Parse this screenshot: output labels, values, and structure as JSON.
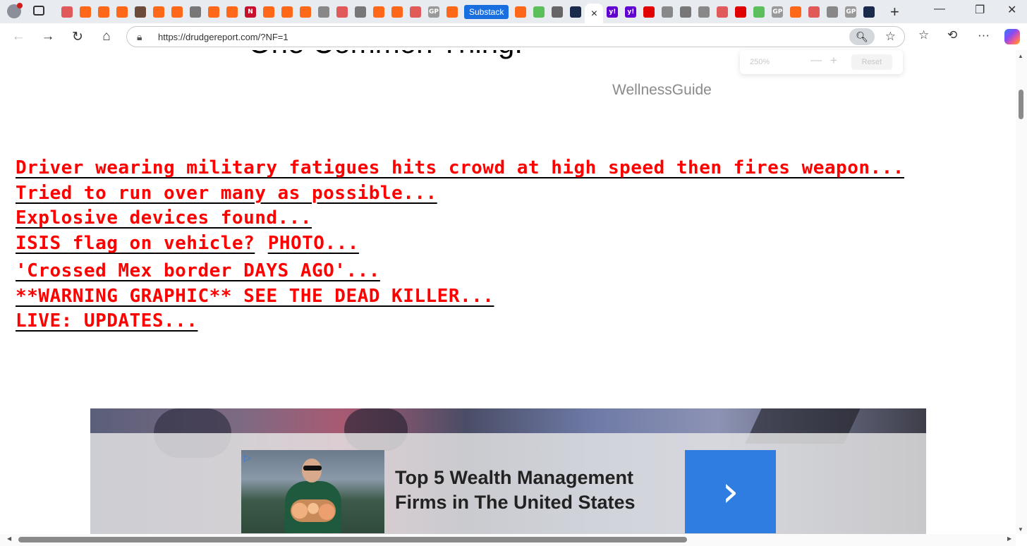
{
  "browser": {
    "tabs": [
      {
        "icon": "youtube-icon",
        "color": "#e05a5a"
      },
      {
        "icon": "substack-icon",
        "color": "#ff6719"
      },
      {
        "icon": "substack-icon",
        "color": "#ff6719"
      },
      {
        "icon": "substack-icon",
        "color": "#ff6719"
      },
      {
        "icon": "avatar-icon",
        "color": "#6b4a3a"
      },
      {
        "icon": "substack-icon",
        "color": "#ff6719"
      },
      {
        "icon": "substack-icon",
        "color": "#ff6719"
      },
      {
        "icon": "lock-icon",
        "color": "#777777"
      },
      {
        "icon": "substack-icon",
        "color": "#ff6719"
      },
      {
        "icon": "substack-icon",
        "color": "#ff6719"
      },
      {
        "icon": "newsmax-icon",
        "color": "#c8102e",
        "letter": "N"
      },
      {
        "icon": "substack-icon",
        "color": "#ff6719"
      },
      {
        "icon": "substack-icon",
        "color": "#ff6719"
      },
      {
        "icon": "substack-icon",
        "color": "#ff6719"
      },
      {
        "icon": "audio-icon",
        "color": "#888888"
      },
      {
        "icon": "youtube-icon",
        "color": "#e05a5a"
      },
      {
        "icon": "mk-icon",
        "color": "#777777"
      },
      {
        "icon": "substack-icon",
        "color": "#ff6719"
      },
      {
        "icon": "substack-icon",
        "color": "#ff6719"
      },
      {
        "icon": "youtube-icon",
        "color": "#e05a5a"
      },
      {
        "icon": "gp-icon",
        "color": "#999999",
        "letter": "GP"
      },
      {
        "icon": "substack-icon",
        "color": "#ff6719"
      }
    ],
    "substack_tab_label": "Substack",
    "tabs_after": [
      {
        "icon": "substack-icon",
        "color": "#ff6719"
      },
      {
        "icon": "play-icon",
        "color": "#5bbf5b"
      },
      {
        "icon": "search-icon",
        "color": "#666666"
      },
      {
        "icon": "fox-icon",
        "color": "#1a2a4a"
      }
    ],
    "tabs_end": [
      {
        "icon": "yahoo-icon",
        "color": "#6001d2",
        "letter": "y!"
      },
      {
        "icon": "yahoo-icon",
        "color": "#6001d2",
        "letter": "y!"
      },
      {
        "icon": "youtube-icon",
        "color": "#e00000"
      },
      {
        "icon": "mail-icon",
        "color": "#888888"
      },
      {
        "icon": "face-icon",
        "color": "#777777"
      },
      {
        "icon": "bird-icon",
        "color": "#888888"
      },
      {
        "icon": "youtube-icon",
        "color": "#e05a5a"
      },
      {
        "icon": "youtube-icon",
        "color": "#e00000"
      },
      {
        "icon": "play-icon",
        "color": "#5bbf5b"
      },
      {
        "icon": "gp-icon",
        "color": "#999999",
        "letter": "GP"
      },
      {
        "icon": "substack-icon",
        "color": "#ff6719"
      },
      {
        "icon": "youtube-icon",
        "color": "#e05a5a"
      },
      {
        "icon": "bird-icon",
        "color": "#888888"
      },
      {
        "icon": "gp-icon",
        "color": "#999999",
        "letter": "GP"
      },
      {
        "icon": "fox-icon",
        "color": "#1a2a4a"
      }
    ],
    "active_tab_close": "×",
    "url": "https://drudgereport.com/?NF=1"
  },
  "zoom_popup": {
    "level": "250%",
    "minus": "—",
    "plus": "+",
    "reset_label": "Reset"
  },
  "page": {
    "ad_top_title": "One Common Thing!",
    "ad_top_source": "WellnessGuide",
    "headlines": [
      "Driver wearing military fatigues hits crowd at high speed then fires weapon...",
      "Tried to run over many as possible...",
      "Explosive devices found..."
    ],
    "headline_isis": "ISIS flag on vehicle?",
    "headline_photo": "PHOTO...",
    "headlines_after": [
      "'Crossed Mex border DAYS AGO'...",
      "**WARNING GRAPHIC** SEE THE DEAD KILLER...",
      "LIVE: UPDATES..."
    ],
    "bottom_ad": {
      "title": "Top 5 Wealth Management Firms in The United States",
      "arrow": "›"
    }
  },
  "colors": {
    "headline": "#ff0000",
    "accent": "#2f7de1",
    "substack_tab": "#1a6fe0"
  }
}
